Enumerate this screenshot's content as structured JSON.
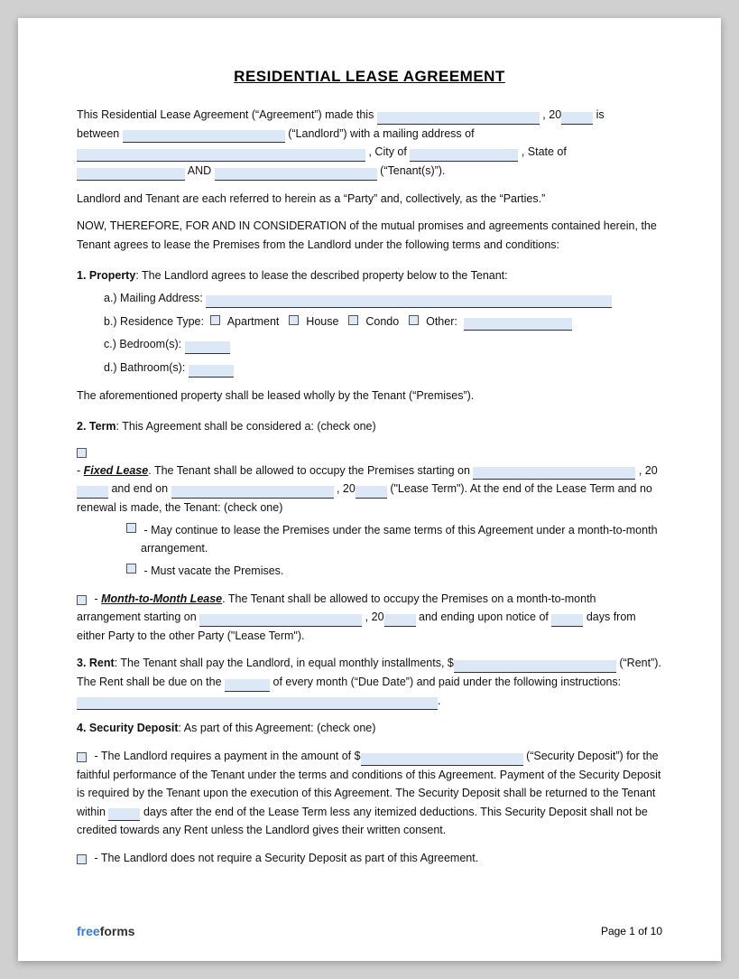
{
  "title": "RESIDENTIAL LEASE AGREEMENT",
  "intro": {
    "line1_pre": "This Residential Lease Agreement (“Agreement”) made this",
    "line1_mid": ", 20",
    "line1_post": "is",
    "line2_pre": "between",
    "line2_mid": "(“Landlord”) with a mailing address of",
    "line3_city_pre": ", City of",
    "line3_post": ", State of",
    "line4_and": "AND",
    "line4_post": "(“Tenant(s)”)."
  },
  "parties_text": "Landlord and Tenant are each referred to herein as a “Party” and, collectively, as the “Parties.”",
  "consideration_text": "NOW, THEREFORE, FOR AND IN CONSIDERATION of the mutual promises and agreements contained herein, the Tenant agrees to lease the Premises from the Landlord under the following terms and conditions:",
  "section1": {
    "heading": "1. Property",
    "intro": ": The Landlord agrees to lease the described property below to the Tenant:",
    "a_label": "a.)  Mailing Address:",
    "b_label": "b.)  Residence Type:",
    "b_options": [
      "Apartment",
      "House",
      "Condo",
      "Other:"
    ],
    "c_label": "c.)  Bedroom(s):",
    "d_label": "d.)  Bathroom(s):",
    "closing": "The aforementioned property shall be leased wholly by the Tenant (“Premises”)."
  },
  "section2": {
    "heading": "2. Term",
    "intro": ": This Agreement shall be considered a: (check one)",
    "fixed_pre": "- ",
    "fixed_label": "Fixed Lease",
    "fixed_text": ". The Tenant shall be allowed to occupy the Premises starting on",
    "fixed_date1": ", 20",
    "fixed_and": "and end on",
    "fixed_date2": ", 20",
    "fixed_term_close": "(“Lease Term”). At the end of the Lease Term and no renewal is made, the Tenant: (check one)",
    "sub1_text": "- May continue to lease the Premises under the same terms of this Agreement under a month-to-month arrangement.",
    "sub2_text": "- Must vacate the Premises.",
    "mtm_pre": "- ",
    "mtm_label": "Month-to-Month Lease",
    "mtm_text": ". The Tenant shall be allowed to occupy the Premises on a month-to-month arrangement starting on",
    "mtm_date": ", 20",
    "mtm_days_pre": "and ending upon notice of",
    "mtm_days": "____",
    "mtm_close": "days from either Party to the other Party (“Lease Term”)."
  },
  "section3": {
    "heading": "3. Rent",
    "text1": ": The Tenant shall pay the Landlord, in equal monthly installments, $",
    "text2": "(“Rent”). The Rent shall be due on the",
    "text3": "of every month (“Due Date”) and paid under the following instructions:",
    "text4": "."
  },
  "section4": {
    "heading": "4. Security Deposit",
    "intro": ": As part of this Agreement: (check one)",
    "opt1_pre": "- The Landlord requires a payment in the amount of $",
    "opt1_post": "(“Security Deposit”) for the faithful performance of the Tenant under the terms and conditions of this Agreement. Payment of the Security Deposit is required by the Tenant upon the execution of this Agreement. The Security Deposit shall be returned to the Tenant within",
    "opt1_days": "____",
    "opt1_close": "days after the end of the Lease Term less any itemized deductions. This Security Deposit shall not be credited towards any Rent unless the Landlord gives their written consent.",
    "opt2": "- The Landlord does not require a Security Deposit as part of this Agreement."
  },
  "footer": {
    "brand_free": "free",
    "brand_forms": "forms",
    "page_text": "Page 1 of 10"
  }
}
